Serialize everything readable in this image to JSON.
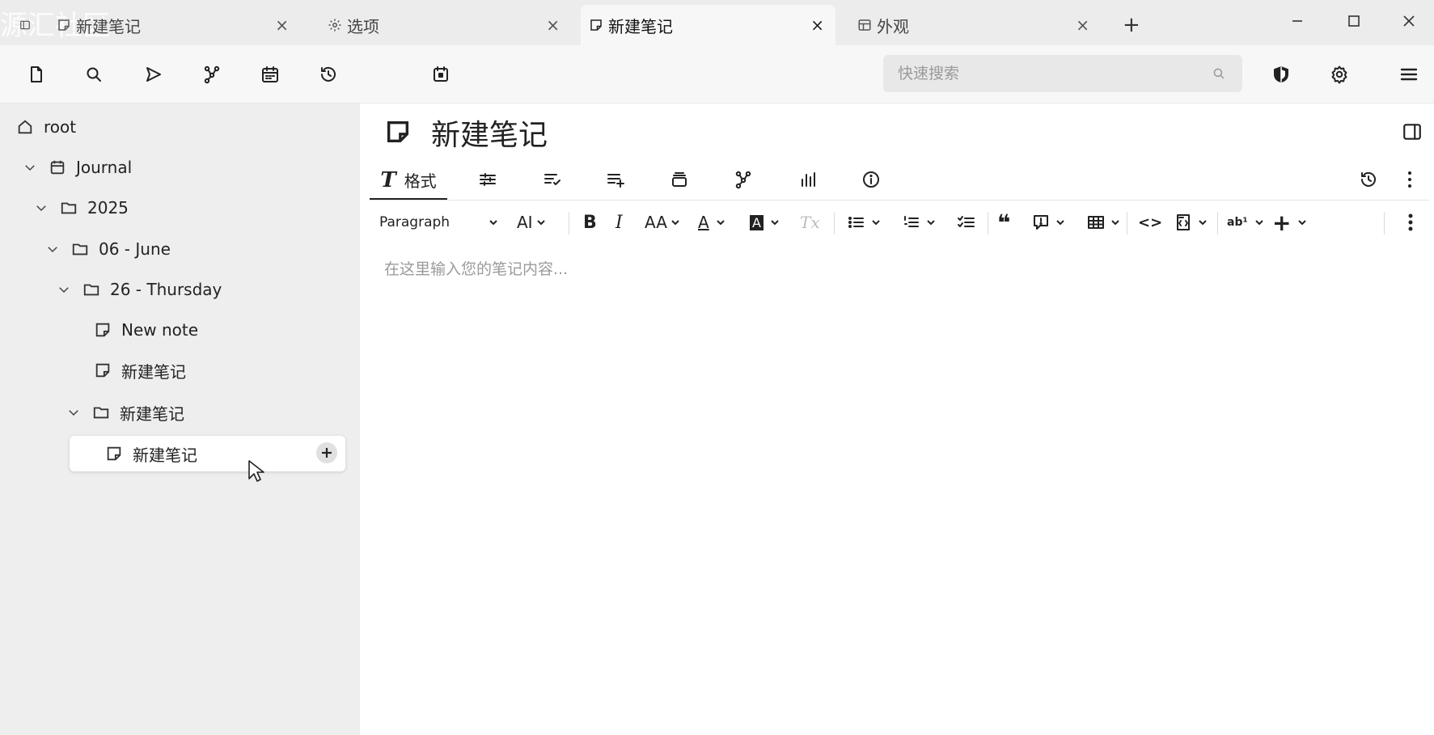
{
  "tabs": [
    {
      "label": "新建笔记",
      "icon": "note-icon",
      "active": false
    },
    {
      "label": "选项",
      "icon": "gear-icon",
      "active": false
    },
    {
      "label": "新建笔记",
      "icon": "note-icon",
      "active": true
    },
    {
      "label": "外观",
      "icon": "layout-icon",
      "active": false
    }
  ],
  "tab_close_glyph": "×",
  "new_tab_glyph": "+",
  "watermark": "源汇社区",
  "toolbar": {
    "icons": [
      "new-note-icon",
      "search-icon",
      "send-icon",
      "graph-icon",
      "calendar-icon",
      "history-icon",
      "today-icon"
    ],
    "search_placeholder": "快速搜索",
    "right_icons": [
      "shield-icon",
      "gear-icon",
      "menu-icon"
    ]
  },
  "tree": {
    "root": "root",
    "journal": "Journal",
    "year": "2025",
    "month": "06 - June",
    "day": "26 - Thursday",
    "note1": "New note",
    "note2": "新建笔记",
    "folder": "新建笔记",
    "selected": "新建笔记"
  },
  "main": {
    "title": "新建笔记",
    "ribbon": {
      "format_label": "格式",
      "format_glyph": "T",
      "tabs": [
        "format",
        "properties",
        "note-info-list",
        "add-list",
        "layers",
        "relation-map",
        "stats",
        "info"
      ]
    },
    "format_toolbar": {
      "paragraph": "Paragraph",
      "heading_size": "AI",
      "bold": "B",
      "italic": "I",
      "font_size": "AA",
      "text_color": "A",
      "bg_color": "A",
      "clear_format": "Tx",
      "quote": "❝",
      "code_inline": "<>",
      "spell": "ab¹",
      "insert": "+"
    },
    "editor_placeholder": "在这里输入您的笔记内容..."
  }
}
